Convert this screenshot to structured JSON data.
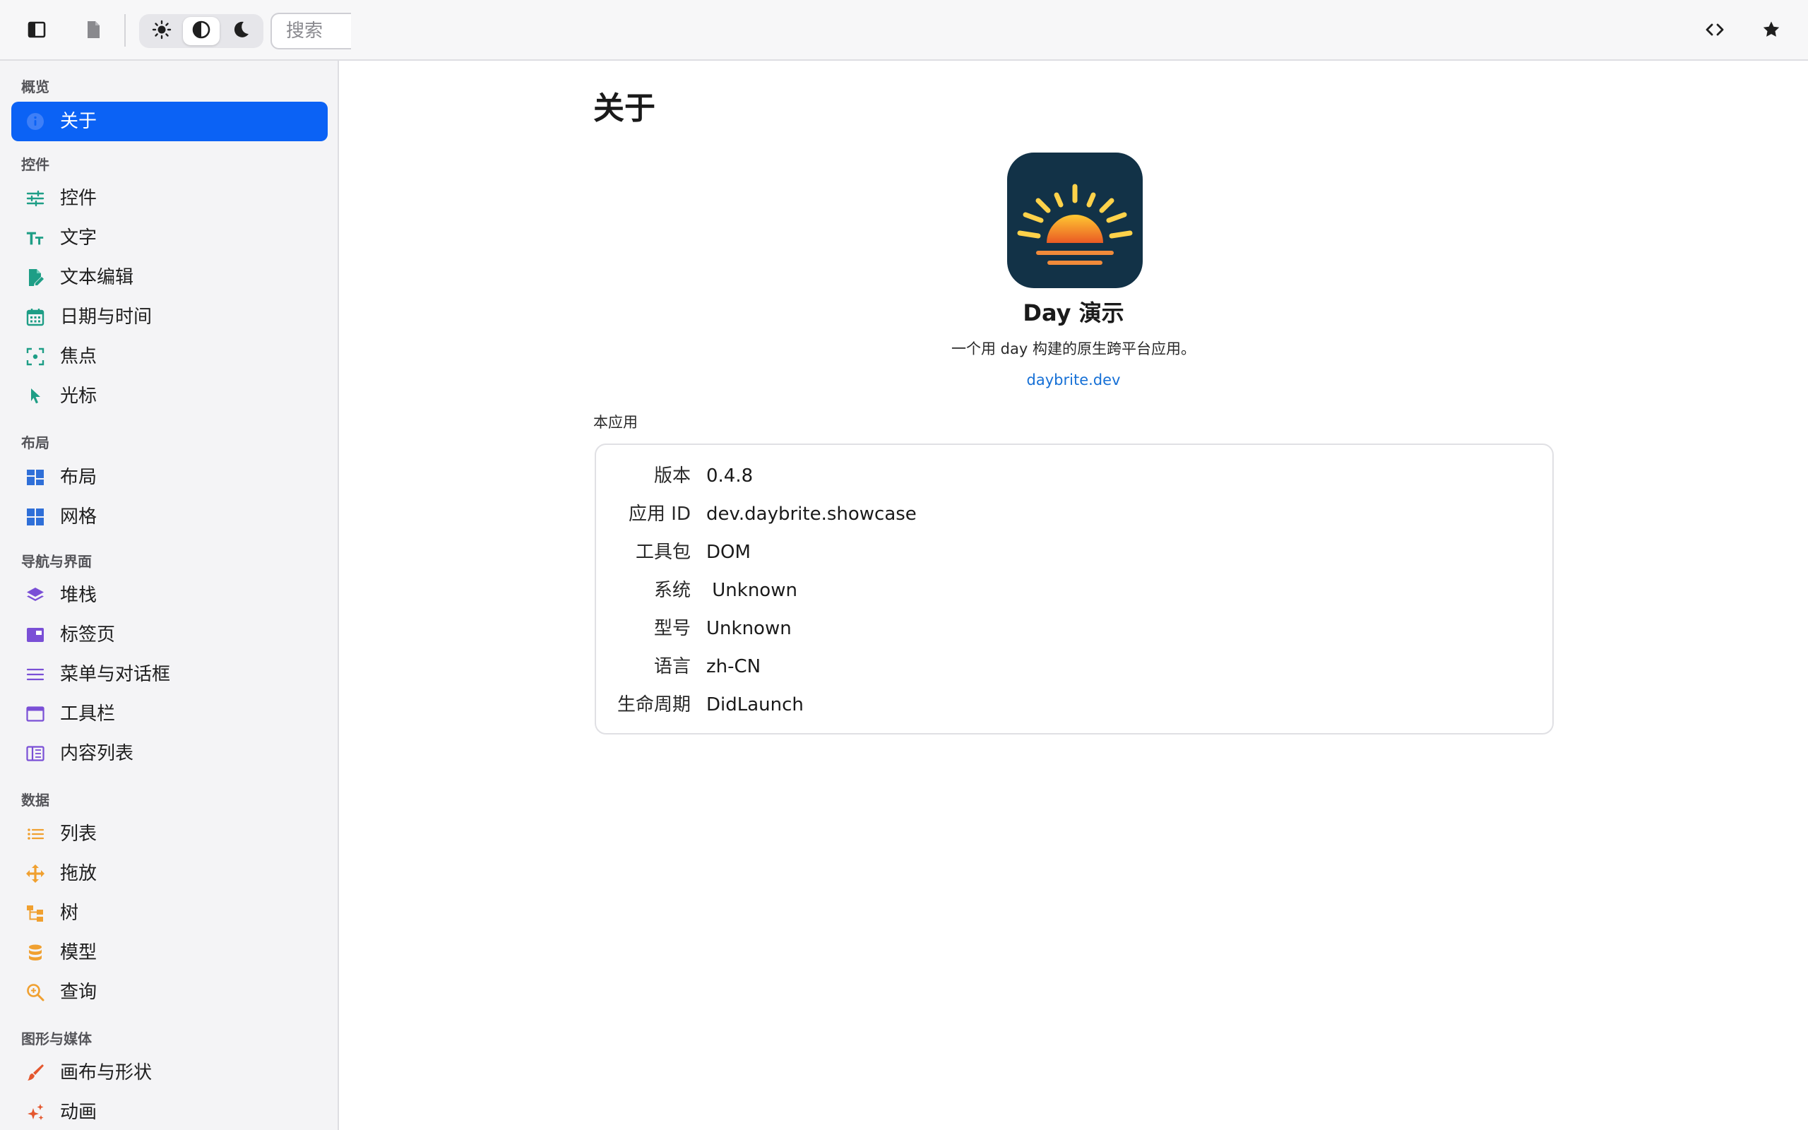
{
  "toolbar": {
    "search_placeholder": "搜索"
  },
  "sidebar": {
    "sections": [
      {
        "title": "概览",
        "items": [
          {
            "label": "关于",
            "icon": "info-icon",
            "active": true
          }
        ]
      },
      {
        "title": "控件",
        "items": [
          {
            "label": "控件",
            "icon": "sliders-icon"
          },
          {
            "label": "文字",
            "icon": "text-size-icon"
          },
          {
            "label": "文本编辑",
            "icon": "edit-document-icon"
          },
          {
            "label": "日期与时间",
            "icon": "calendar-icon"
          },
          {
            "label": "焦点",
            "icon": "focus-icon"
          },
          {
            "label": "光标",
            "icon": "cursor-icon"
          }
        ]
      },
      {
        "title": "布局",
        "items": [
          {
            "label": "布局",
            "icon": "layout-icon"
          },
          {
            "label": "网格",
            "icon": "grid-icon"
          }
        ]
      },
      {
        "title": "导航与界面",
        "items": [
          {
            "label": "堆栈",
            "icon": "stack-icon"
          },
          {
            "label": "标签页",
            "icon": "tabs-icon"
          },
          {
            "label": "菜单与对话框",
            "icon": "menu-icon"
          },
          {
            "label": "工具栏",
            "icon": "toolbar-icon"
          },
          {
            "label": "内容列表",
            "icon": "content-list-icon"
          }
        ]
      },
      {
        "title": "数据",
        "items": [
          {
            "label": "列表",
            "icon": "list-icon"
          },
          {
            "label": "拖放",
            "icon": "move-icon"
          },
          {
            "label": "树",
            "icon": "tree-icon"
          },
          {
            "label": "模型",
            "icon": "database-icon"
          },
          {
            "label": "查询",
            "icon": "search-icon"
          }
        ]
      },
      {
        "title": "图形与媒体",
        "items": [
          {
            "label": "画布与形状",
            "icon": "brush-icon"
          },
          {
            "label": "动画",
            "icon": "sparkle-icon"
          }
        ]
      }
    ]
  },
  "main": {
    "title": "关于",
    "app_name": "Day 演示",
    "app_description": "一个用 day 构建的原生跨平台应用。",
    "app_link": "daybrite.dev",
    "group_label": "本应用",
    "info": [
      {
        "key": "版本",
        "value": "0.4.8"
      },
      {
        "key": "应用 ID",
        "value": "dev.daybrite.showcase"
      },
      {
        "key": "工具包",
        "value": "DOM"
      },
      {
        "key": "系统",
        "value": " Unknown"
      },
      {
        "key": "型号",
        "value": "Unknown"
      },
      {
        "key": "语言",
        "value": "zh-CN"
      },
      {
        "key": "生命周期",
        "value": "DidLaunch"
      }
    ]
  },
  "colors": {
    "accent": "#0b62f5",
    "link": "#1670d6",
    "green": "#1e9e86",
    "blue": "#2f6fd8",
    "purple": "#7a4fd6",
    "orange": "#f0a030",
    "red": "#e4572e",
    "app_icon_bg": "#123247"
  }
}
